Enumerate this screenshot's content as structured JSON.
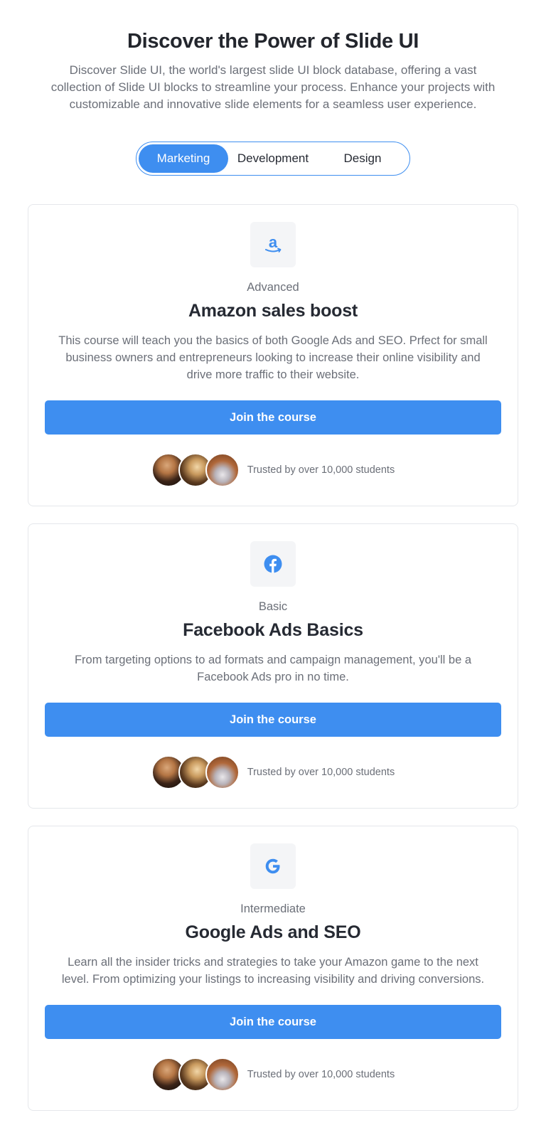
{
  "header": {
    "title": "Discover the Power of Slide UI",
    "subtitle": "Discover Slide UI, the world's largest slide UI block database, offering a vast collection of Slide UI blocks to streamline your process. Enhance your projects with customizable and innovative slide elements for a seamless user experience."
  },
  "tabs": [
    {
      "label": "Marketing",
      "active": true
    },
    {
      "label": "Development",
      "active": false
    },
    {
      "label": "Design",
      "active": false
    }
  ],
  "cards": [
    {
      "icon": "amazon-icon",
      "level": "Advanced",
      "title": "Amazon sales boost",
      "description": "This course will teach you the basics of both Google Ads and SEO. Prfect for small business owners and entrepreneurs looking to increase their online visibility and drive more traffic to their website.",
      "button_label": "Join the course",
      "trust_text": "Trusted by over 10,000 students"
    },
    {
      "icon": "facebook-icon",
      "level": "Basic",
      "title": "Facebook Ads Basics",
      "description": "From targeting options to ad formats and campaign management, you'll be a Facebook Ads pro in no time.",
      "button_label": "Join the course",
      "trust_text": "Trusted by over 10,000 students"
    },
    {
      "icon": "google-icon",
      "level": "Intermediate",
      "title": "Google Ads and SEO",
      "description": "Learn all the insider tricks and strategies to take your Amazon game to the next level. From optimizing your listings to increasing visibility and driving conversions.",
      "button_label": "Join the course",
      "trust_text": "Trusted by over 10,000 students"
    }
  ],
  "colors": {
    "accent": "#3e8ef0",
    "text": "#262a33",
    "muted": "#6b6f78",
    "icon_bg": "#f4f5f7",
    "border": "#e5e7eb"
  }
}
